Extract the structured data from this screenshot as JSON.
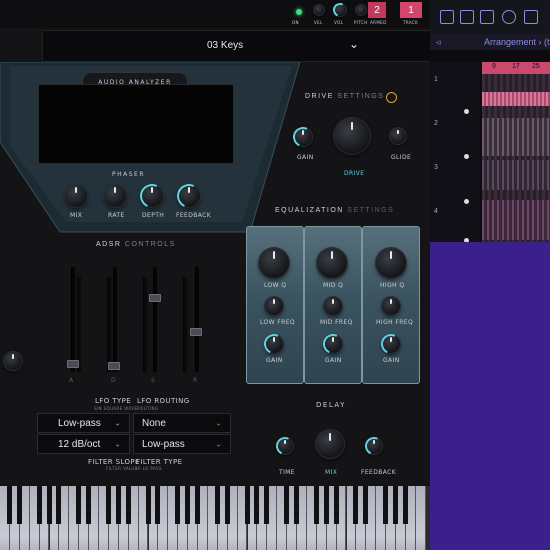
{
  "header": {
    "preset": "03 Keys",
    "transport_labels": [
      "ON",
      "VEL",
      "VOL",
      "PITCH",
      "ARMED",
      "TRACK"
    ],
    "armed_value": "2",
    "track_value": "1"
  },
  "analyzer": {
    "title": "AUDIO ANALYZER"
  },
  "phaser": {
    "title": "PHASER",
    "knobs": [
      "MIX",
      "RATE",
      "DEPTH",
      "FEEDBACK"
    ]
  },
  "drive": {
    "title": "DRIVE",
    "title_sub": "SETTINGS",
    "gain": "GAIN",
    "drive": "DRIVE",
    "glide": "GLIDE"
  },
  "adsr": {
    "title": "ADSR",
    "title_sub": "CONTROLS",
    "letters": [
      "A",
      "D",
      "S",
      "R"
    ]
  },
  "eq": {
    "title": "EQUALIZATION",
    "title_sub": "SETTINGS",
    "cols": [
      {
        "q": "LOW Q",
        "freq": "LOW FREQ",
        "gain": "GAIN"
      },
      {
        "q": "MID Q",
        "freq": "MID FREQ",
        "gain": "GAIN"
      },
      {
        "q": "HIGH Q",
        "freq": "HIGH FREQ",
        "gain": "GAIN"
      }
    ]
  },
  "delay": {
    "title": "DELAY",
    "time": "TIME",
    "mix": "MIX",
    "feedback": "FEEDBACK"
  },
  "filter": {
    "lfo_type_label": "LFO TYPE",
    "lfo_type_sub": "SIN SQUARE WAVE",
    "lfo_routing_label": "LFO ROUTING",
    "lfo_routing_sub": "ROUTING",
    "type_value": "Low-pass",
    "routing_value": "None",
    "slope_value": "12 dB/oct",
    "filter_type_value": "Low-pass",
    "slope_label": "FILTER SLOPE",
    "slope_sub": "FILTER VALUE",
    "filter_type_label": "FILTER TYPE",
    "filter_type_sub": "HI LO PASS"
  },
  "arrangement": {
    "label": "Arrangement",
    "label_suffix": "› (t",
    "ruler": [
      "9",
      "17",
      "25"
    ],
    "tracks": [
      "1",
      "2",
      "3",
      "4"
    ]
  },
  "colors": {
    "accent": "#5fd3e0",
    "record": "#d4456a",
    "brand": "#e0a040",
    "daw_bg": "#3b1f8a"
  }
}
